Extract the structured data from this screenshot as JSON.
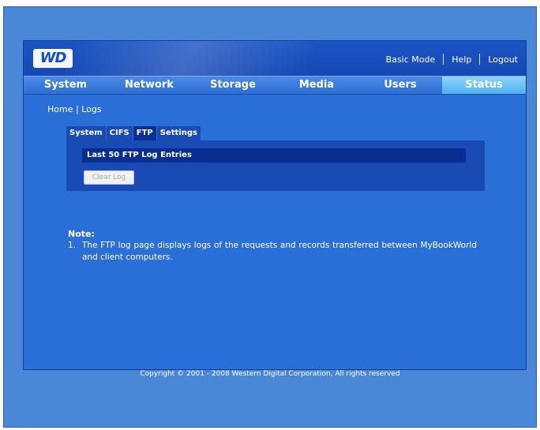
{
  "header": {
    "logo_text": "WD",
    "links": {
      "basic_mode": "Basic Mode",
      "help": "Help",
      "logout": "Logout"
    }
  },
  "nav": {
    "tabs": [
      {
        "label": "System"
      },
      {
        "label": "Network"
      },
      {
        "label": "Storage"
      },
      {
        "label": "Media"
      },
      {
        "label": "Users"
      },
      {
        "label": "Status",
        "active": true
      }
    ]
  },
  "breadcrumb": {
    "home": "Home",
    "separator": "|",
    "current": "Logs"
  },
  "subtabs": [
    {
      "label": "System"
    },
    {
      "label": "CIFS"
    },
    {
      "label": "FTP",
      "active": true
    },
    {
      "label": "Settings"
    }
  ],
  "log_panel": {
    "header": "Last 50 FTP Log Entries",
    "clear_button": "Clear Log"
  },
  "note": {
    "title": "Note:",
    "number": "1.",
    "text": "The FTP log page displays logs of the requests and records transferred between MyBookWorld and client computers."
  },
  "footer": {
    "copyright": "Copyright © 2001 - 2008 Western Digital Corporation, All rights reserved"
  },
  "colors": {
    "page_background": "#4a87d6",
    "frame_background": "#2a6fd8",
    "header_background": "#1b55c4",
    "active_tab": "#6cc4fb",
    "panel": "#1a4bb5",
    "log_bar": "#0a2d92"
  }
}
